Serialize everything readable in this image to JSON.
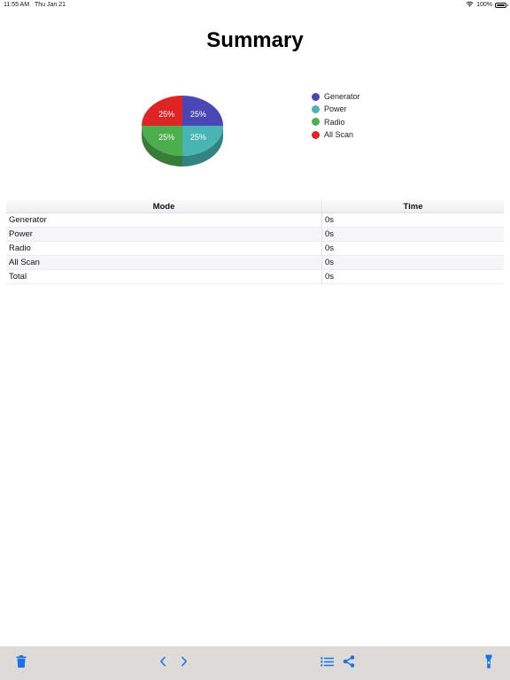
{
  "status": {
    "time": "11:55 AM",
    "date": "Thu Jan 21",
    "battery": "100%"
  },
  "title": "Summary",
  "chart_data": {
    "type": "pie",
    "title": "",
    "slices": [
      {
        "name": "Generator",
        "value": 25,
        "label": "25%",
        "color": "#4a46b5"
      },
      {
        "name": "Power",
        "value": 25,
        "label": "25%",
        "color": "#49b4b4"
      },
      {
        "name": "Radio",
        "value": 25,
        "label": "25%",
        "color": "#4cae4c"
      },
      {
        "name": "All Scan",
        "value": 25,
        "label": "25%",
        "color": "#de2424"
      }
    ],
    "legend_position": "right"
  },
  "table": {
    "headers": {
      "mode": "Mode",
      "time": "Time"
    },
    "rows": [
      {
        "mode": "Generator",
        "time": "0s"
      },
      {
        "mode": "Power",
        "time": "0s"
      },
      {
        "mode": "Radio",
        "time": "0s"
      },
      {
        "mode": "All Scan",
        "time": "0s"
      },
      {
        "mode": "Total",
        "time": "0s"
      }
    ]
  },
  "toolbar": {
    "accent": "#1a73e8",
    "buttons": [
      "trash-icon",
      "chevron-left-icon",
      "chevron-right-icon",
      "list-icon",
      "share-icon",
      "flashlight-icon"
    ]
  }
}
